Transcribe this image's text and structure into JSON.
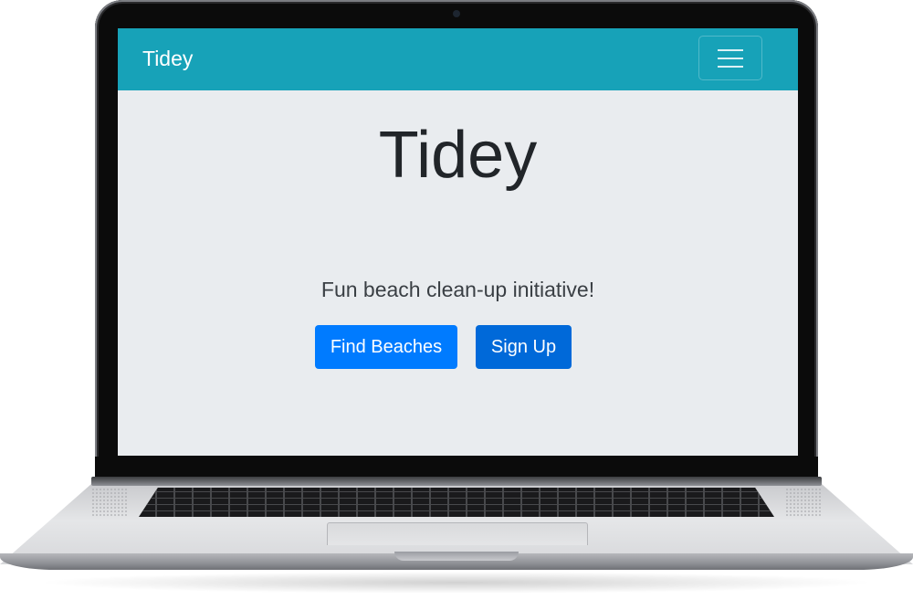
{
  "navbar": {
    "brand": "Tidey",
    "toggler_icon": "hamburger-menu-icon",
    "background_color": "#17a2b8"
  },
  "hero": {
    "title": "Tidey",
    "lead": "Fun beach clean-up initiative!",
    "background_color": "#e9ecef"
  },
  "buttons": {
    "find_beaches": "Find Beaches",
    "sign_up": "Sign Up",
    "primary_color": "#007bff",
    "primary_hover_color": "#0069d9"
  }
}
